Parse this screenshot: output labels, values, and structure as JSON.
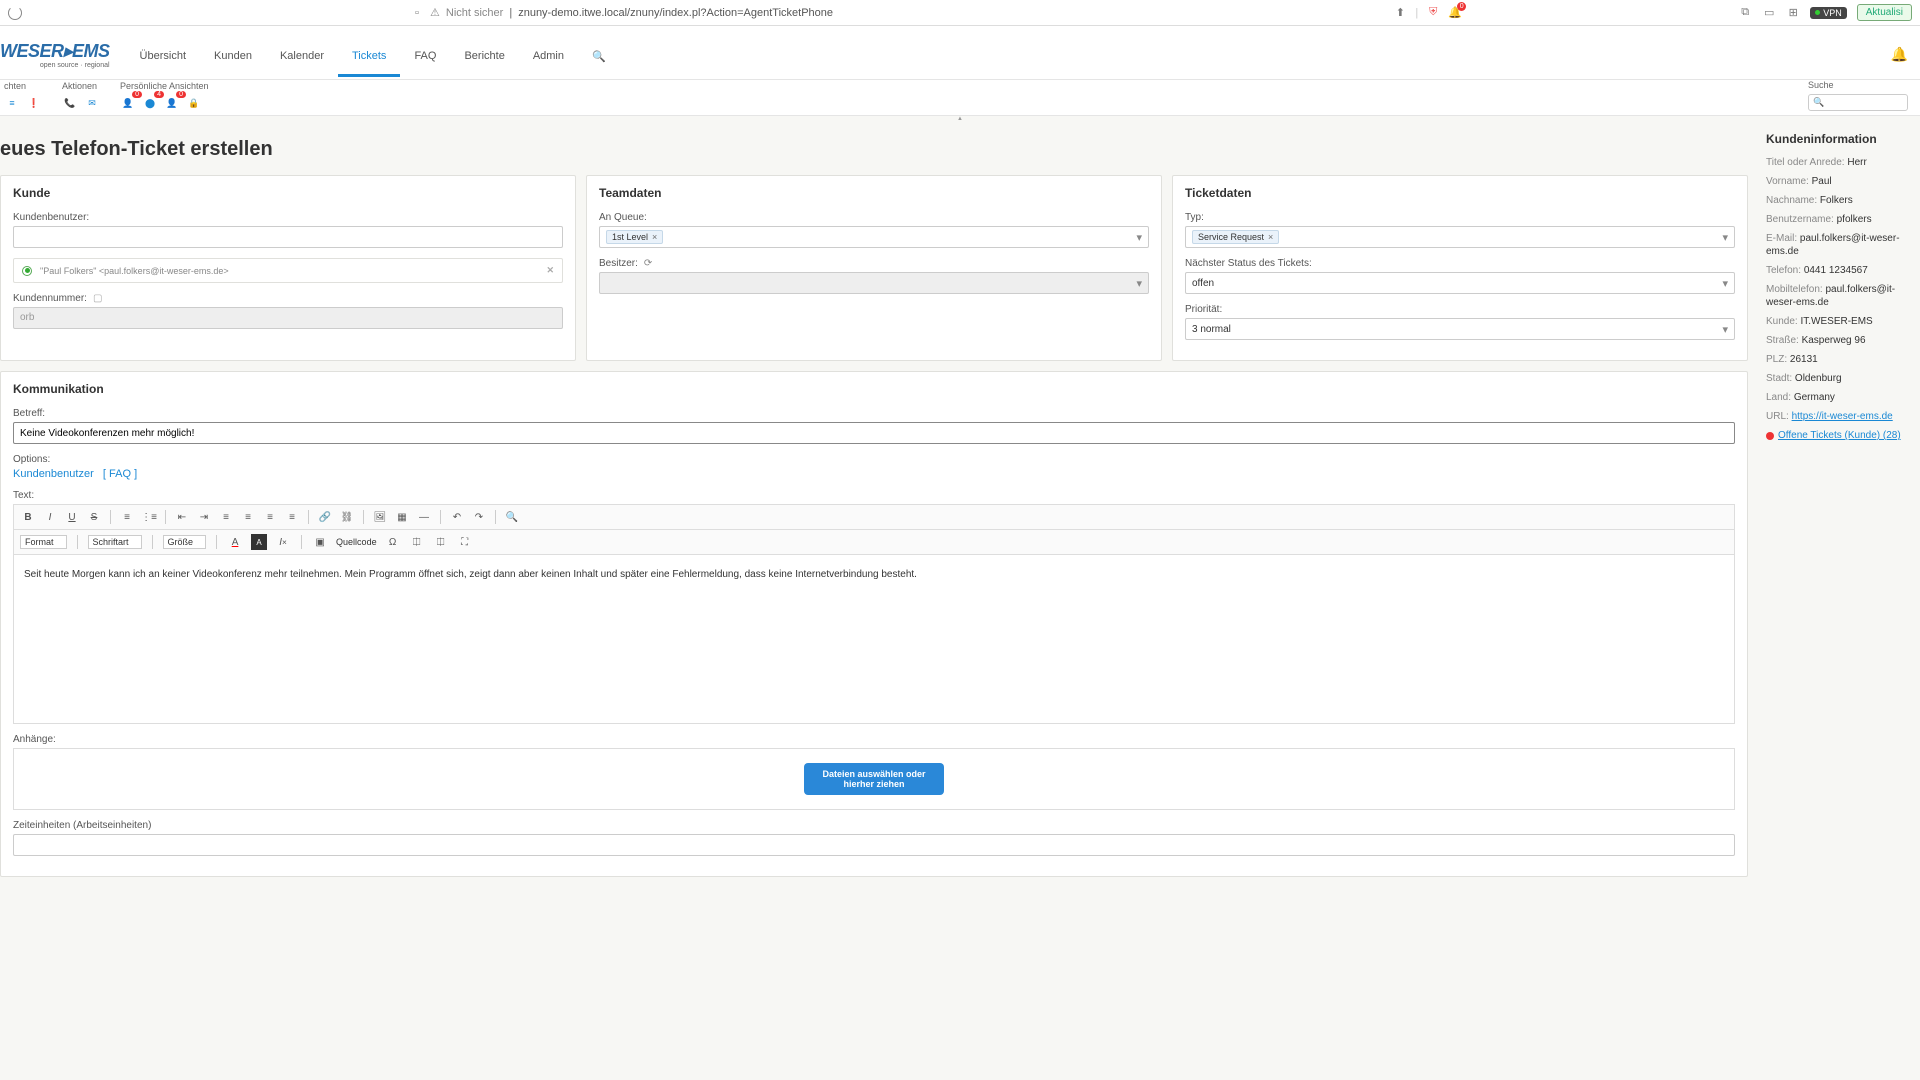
{
  "browser": {
    "insecure": "Nicht sicher",
    "url": "znuny-demo.itwe.local/znuny/index.pl?Action=AgentTicketPhone",
    "vpn": "VPN",
    "refresh": "Aktualisi"
  },
  "logo": {
    "text": "WESER▸EMS",
    "sub": "open source · regional"
  },
  "nav": {
    "items": [
      "Übersicht",
      "Kunden",
      "Kalender",
      "Tickets",
      "FAQ",
      "Berichte",
      "Admin"
    ],
    "active": "Tickets"
  },
  "subheader": {
    "group1": "chten",
    "group2": "Aktionen",
    "group3": "Persönliche Ansichten",
    "search": "Suche"
  },
  "page_title": "eues Telefon-Ticket erstellen",
  "panels": {
    "kunde": {
      "title": "Kunde",
      "user_label": "Kundenbenutzer:",
      "user_value": "\"Paul Folkers\" <paul.folkers@it-weser-ems.de>",
      "num_label": "Kundennummer:",
      "num_value": "orb"
    },
    "team": {
      "title": "Teamdaten",
      "queue_label": "An Queue:",
      "queue_value": "1st Level",
      "owner_label": "Besitzer:"
    },
    "ticket": {
      "title": "Ticketdaten",
      "type_label": "Typ:",
      "type_value": "Service Request",
      "status_label": "Nächster Status des Tickets:",
      "status_value": "offen",
      "prio_label": "Priorität:",
      "prio_value": "3 normal"
    }
  },
  "comm": {
    "title": "Kommunikation",
    "subject_label": "Betreff:",
    "subject_value": "Keine Videokonferenzen mehr möglich!",
    "options_label": "Options:",
    "link1": "Kundenbenutzer",
    "link2": "[ FAQ ]",
    "text_label": "Text:",
    "format": "Format",
    "font": "Schriftart",
    "size": "Größe",
    "source": "Quellcode",
    "body": "Seit heute Morgen kann ich an keiner Videokonferenz mehr teilnehmen. Mein Programm öffnet sich, zeigt dann aber keinen Inhalt und später eine Fehlermeldung, dass keine Internetverbindung besteht.",
    "attach_label": "Anhänge:",
    "attach_btn": "Dateien auswählen oder hierher ziehen",
    "time_label": "Zeiteinheiten (Arbeitseinheiten)"
  },
  "sidebar": {
    "title": "Kundeninformation",
    "rows": [
      {
        "l": "Titel oder Anrede:",
        "v": "Herr"
      },
      {
        "l": "Vorname:",
        "v": "Paul"
      },
      {
        "l": "Nachname:",
        "v": "Folkers"
      },
      {
        "l": "Benutzername:",
        "v": "pfolkers"
      },
      {
        "l": "E-Mail:",
        "v": "paul.folkers@it-weser-ems.de"
      },
      {
        "l": "Telefon:",
        "v": "0441 1234567"
      },
      {
        "l": "Mobiltelefon:",
        "v": "paul.folkers@it-weser-ems.de"
      },
      {
        "l": "Kunde:",
        "v": "IT.WESER-EMS"
      },
      {
        "l": "Straße:",
        "v": "Kasperweg 96"
      },
      {
        "l": "PLZ:",
        "v": "26131"
      },
      {
        "l": "Stadt:",
        "v": "Oldenburg"
      },
      {
        "l": "Land:",
        "v": "Germany"
      }
    ],
    "url_l": "URL:",
    "url_v": "https://it-weser-ems.de",
    "tickets": "Offene Tickets (Kunde) (28)"
  }
}
